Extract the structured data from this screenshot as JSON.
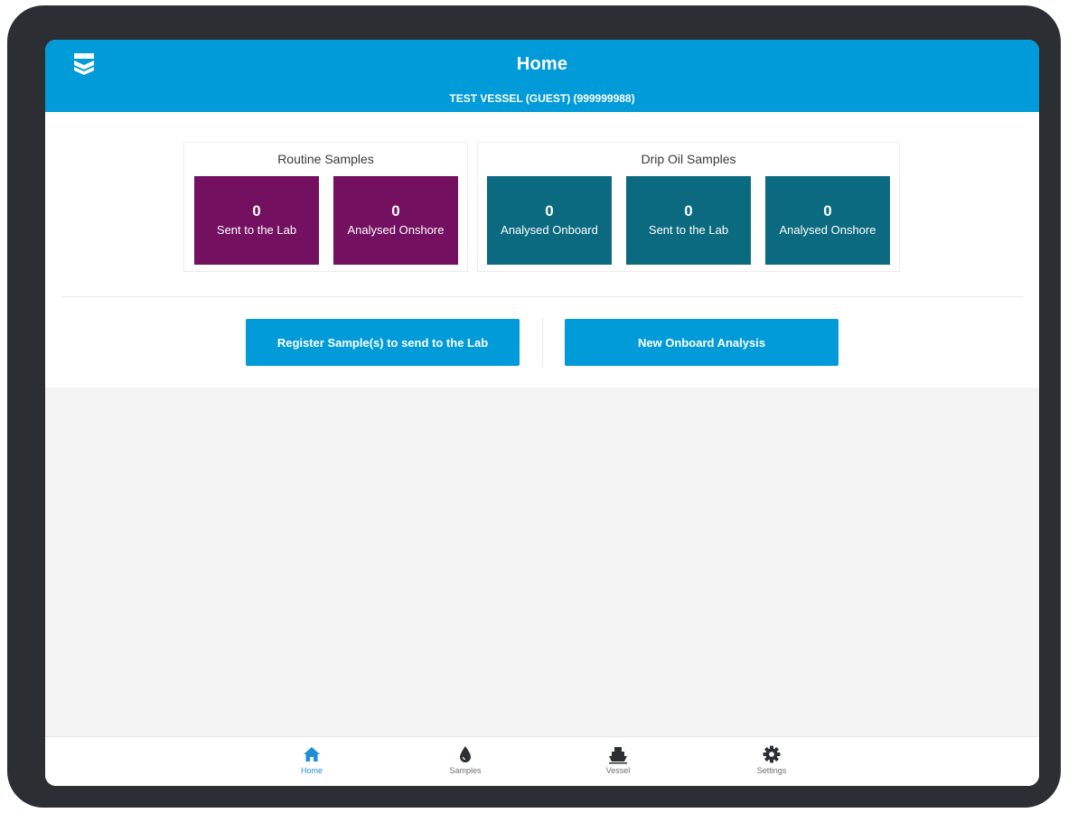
{
  "header": {
    "title": "Home",
    "subtitle": "TEST VESSEL (GUEST) (999999988)",
    "logo_icon": "chevron-logo-icon"
  },
  "routine": {
    "title": "Routine Samples",
    "tiles": [
      {
        "count": "0",
        "label": "Sent to the Lab"
      },
      {
        "count": "0",
        "label": "Analysed Onshore"
      }
    ]
  },
  "drip": {
    "title": "Drip Oil Samples",
    "tiles": [
      {
        "count": "0",
        "label": "Analysed Onboard"
      },
      {
        "count": "0",
        "label": "Sent to the Lab"
      },
      {
        "count": "0",
        "label": "Analysed Onshore"
      }
    ]
  },
  "actions": {
    "register_label": "Register Sample(s) to send to the Lab",
    "new_analysis_label": "New Onboard Analysis"
  },
  "tabs": [
    {
      "label": "Home",
      "icon": "home-icon",
      "active": true
    },
    {
      "label": "Samples",
      "icon": "drop-icon",
      "active": false
    },
    {
      "label": "Vessel",
      "icon": "ship-icon",
      "active": false
    },
    {
      "label": "Settings",
      "icon": "gear-icon",
      "active": false
    }
  ],
  "colors": {
    "primary": "#009bd8",
    "routine_tile": "#731060",
    "drip_tile": "#0b6a80",
    "frame": "#2b2f33",
    "content_bg": "#f4f4f4",
    "active_tab": "#1f8ed6"
  }
}
